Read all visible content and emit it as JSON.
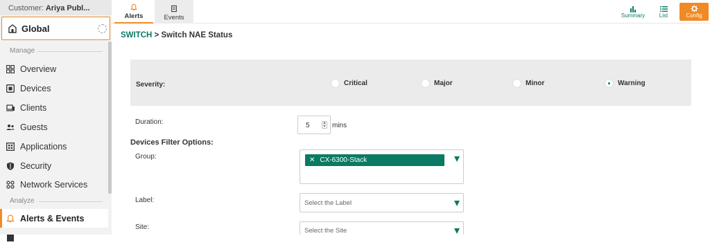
{
  "customer": {
    "prefix": "Customer:",
    "name": "Ariya Publ..."
  },
  "scope": {
    "label": "Global"
  },
  "sections": {
    "manage": "Manage",
    "analyze": "Analyze"
  },
  "nav": [
    {
      "label": "Overview",
      "icon": "overview-icon"
    },
    {
      "label": "Devices",
      "icon": "devices-icon"
    },
    {
      "label": "Clients",
      "icon": "clients-icon"
    },
    {
      "label": "Guests",
      "icon": "guests-icon"
    },
    {
      "label": "Applications",
      "icon": "applications-icon"
    },
    {
      "label": "Security",
      "icon": "security-icon"
    },
    {
      "label": "Network Services",
      "icon": "network-services-icon"
    }
  ],
  "nav_active": {
    "label": "Alerts & Events",
    "icon": "bell-icon"
  },
  "tabs": {
    "alerts": "Alerts",
    "events": "Events"
  },
  "right_actions": {
    "summary": "Summary",
    "list": "List",
    "config": "Config"
  },
  "breadcrumb": {
    "link": "SWITCH",
    "separator": " > ",
    "current": "Switch NAE Status"
  },
  "severity": {
    "label": "Severity:",
    "options": [
      "Critical",
      "Major",
      "Minor",
      "Warning"
    ],
    "selected": "Warning"
  },
  "duration": {
    "label": "Duration:",
    "value": "5",
    "unit": "mins"
  },
  "filters": {
    "heading": "Devices Filter Options:",
    "group_label": "Group:",
    "group_chip": "CX-6300-Stack",
    "label_label": "Label:",
    "label_placeholder": "Select the Label",
    "site_label": "Site:",
    "site_placeholder": "Select the Site"
  },
  "colors": {
    "accent": "#f08a24",
    "brand": "#0a7a63"
  }
}
